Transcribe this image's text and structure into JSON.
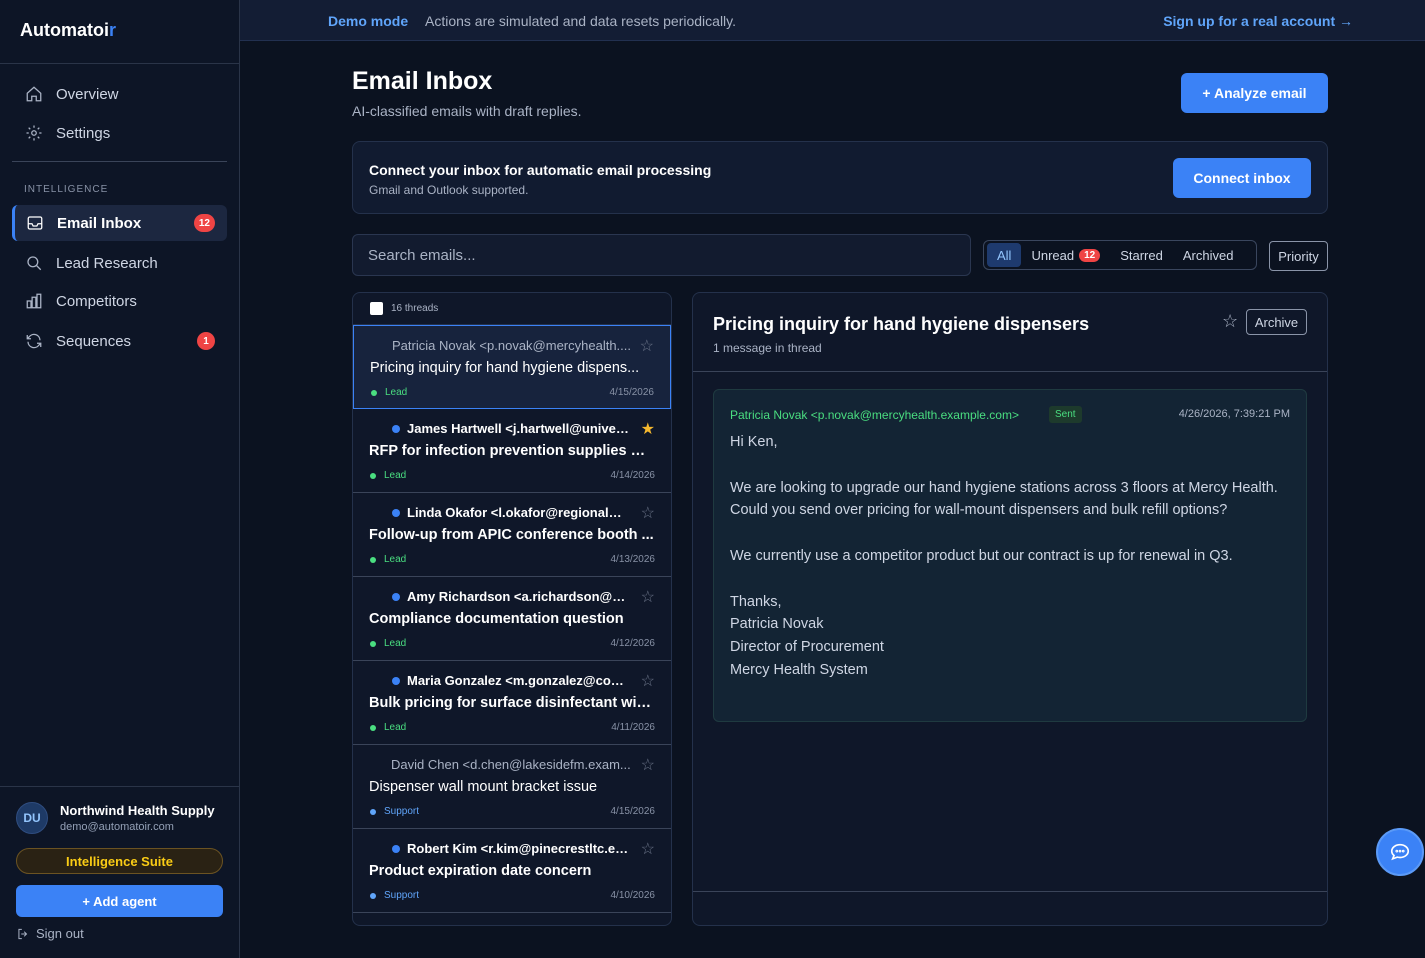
{
  "brand": {
    "name": "Automatoi",
    "accent": "r"
  },
  "sidebar": {
    "nav": [
      {
        "label": "Overview",
        "icon": "home-icon"
      },
      {
        "label": "Settings",
        "icon": "gear-icon"
      }
    ],
    "section_label": "INTELLIGENCE",
    "items": [
      {
        "label": "Email Inbox",
        "icon": "inbox-icon",
        "badge": "12",
        "active": true
      },
      {
        "label": "Lead Research",
        "icon": "search-icon"
      },
      {
        "label": "Competitors",
        "icon": "bar-chart-icon"
      },
      {
        "label": "Sequences",
        "icon": "refresh-icon",
        "badge": "1"
      }
    ],
    "org": {
      "initials": "DU",
      "name": "Northwind Health Supply",
      "email": "demo@automatoir.com"
    },
    "suite_label": "Intelligence Suite",
    "add_agent_label": "+ Add agent",
    "sign_out_label": "Sign out"
  },
  "banner": {
    "demo_label": "Demo mode",
    "demo_text": "Actions are simulated and data resets periodically.",
    "signup_label": "Sign up for a real account →"
  },
  "header": {
    "title": "Email Inbox",
    "subtitle": "AI-classified emails with draft replies.",
    "analyze_label": "+ Analyze email"
  },
  "connect": {
    "title": "Connect your inbox for automatic email processing",
    "subtitle": "Gmail and Outlook supported.",
    "button_label": "Connect inbox"
  },
  "search": {
    "placeholder": "Search emails..."
  },
  "filters": {
    "tabs": [
      {
        "label": "All",
        "active": true
      },
      {
        "label": "Unread",
        "count": "12"
      },
      {
        "label": "Starred"
      },
      {
        "label": "Archived"
      }
    ],
    "priority_label": "Priority"
  },
  "threads": {
    "count_label": "16 threads",
    "items": [
      {
        "from": "Patricia Novak <p.novak@mercyhealth....",
        "subject": "Pricing inquiry for hand hygiene dispens...",
        "tag": "Lead",
        "date": "4/15/2026",
        "unread": false,
        "starred": false,
        "selected": true
      },
      {
        "from": "James Hartwell <j.hartwell@univers...",
        "subject": "RFP for infection prevention supplies — ...",
        "tag": "Lead",
        "date": "4/14/2026",
        "unread": true,
        "starred": true
      },
      {
        "from": "Linda Okafor <l.okafor@regionalhos...",
        "subject": "Follow-up from APIC conference booth ...",
        "tag": "Lead",
        "date": "4/13/2026",
        "unread": true,
        "starred": false
      },
      {
        "from": "Amy Richardson <a.richardson@rap...",
        "subject": "Compliance documentation question",
        "tag": "Lead",
        "date": "4/12/2026",
        "unread": true,
        "starred": false
      },
      {
        "from": "Maria Gonzalez <m.gonzalez@com...",
        "subject": "Bulk pricing for surface disinfectant wipes",
        "tag": "Lead",
        "date": "4/11/2026",
        "unread": true,
        "starred": false
      },
      {
        "from": "David Chen <d.chen@lakesidefm.exam...",
        "subject": "Dispenser wall mount bracket issue",
        "tag": "Support",
        "date": "4/15/2026",
        "unread": false,
        "starred": false
      },
      {
        "from": "Robert Kim <r.kim@pinecrestltc.exa...",
        "subject": "Product expiration date concern",
        "tag": "Support",
        "date": "4/10/2026",
        "unread": true,
        "starred": false
      }
    ]
  },
  "detail": {
    "title": "Pricing inquiry for hand hygiene dispensers",
    "meta": "1 message in thread",
    "archive_label": "Archive",
    "message": {
      "from": "Patricia Novak <p.novak@mercyhealth.example.com>",
      "status": "Sent",
      "date": "4/26/2026, 7:39:21 PM",
      "greeting": "Hi Ken,",
      "para1": "We are looking to upgrade our hand hygiene stations across 3 floors at Mercy Health. Could you send over pricing for wall-mount dispensers and bulk refill options?",
      "para2": "We currently use a competitor product but our contract is up for renewal in Q3.",
      "signoff": "Thanks,",
      "sig_name": "Patricia Novak",
      "sig_title": "Director of Procurement",
      "sig_org": "Mercy Health System"
    }
  },
  "colors": {
    "accent": "#3b82f6",
    "lead": "#4ade80",
    "support": "#60a5fa",
    "badge": "#ef4444",
    "star": "#f5b82e"
  }
}
